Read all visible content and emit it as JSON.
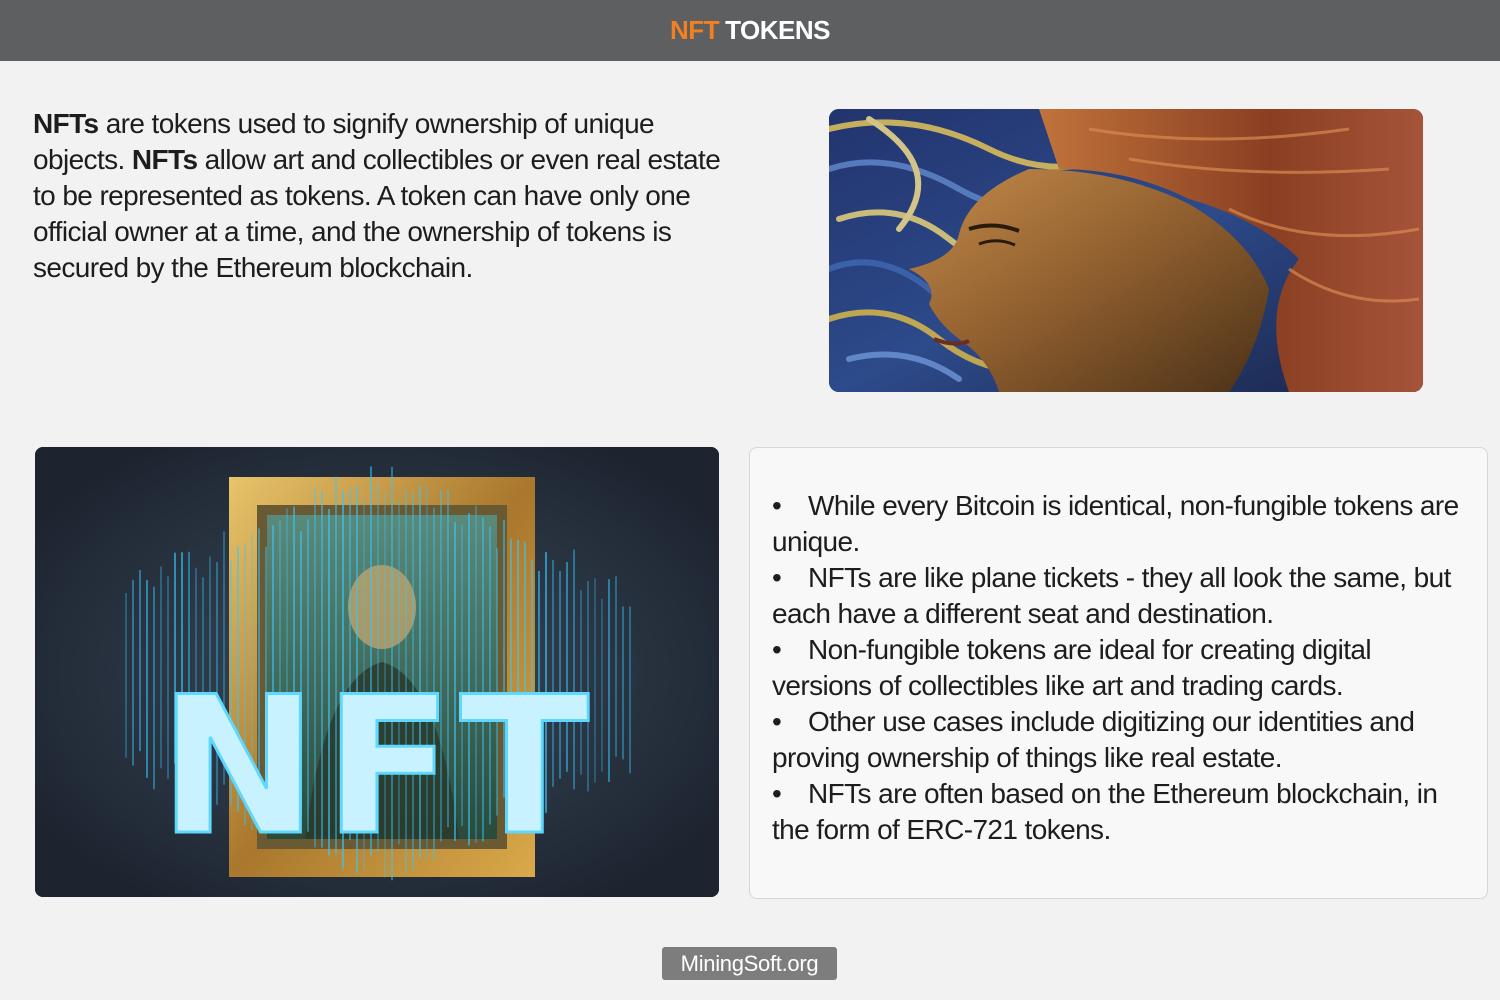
{
  "header": {
    "title_accent": "NFT",
    "title_rest": "TOKENS"
  },
  "intro": {
    "p1_bold": "NFTs",
    "p1_text": " are tokens used to signify ownership of unique objects. ",
    "p2_bold": "NFTs",
    "p2_text": " allow art and collectibles or even real estate to be represented as tokens. A token can have only one official owner at a time, and the ownership of tokens is secured by the Ethereum blockchain."
  },
  "images": {
    "portrait": {
      "icon": "painted-portrait-image"
    },
    "nft": {
      "icon": "mona-lisa-nft-image",
      "overlay_text": "NFT"
    }
  },
  "bullets": {
    "bullet_char": "•",
    "items": [
      "While every Bitcoin is identical, non-fungible tokens are unique.",
      "NFTs are like plane tickets - they all look the same, but each have a different seat and destination.",
      "Non-fungible tokens are ideal for creating digital versions of collectibles like art and trading cards.",
      "Other use cases include digitizing our identities and proving ownership of things like real estate.",
      "NFTs are often based on the Ethereum blockchain, in the form of ERC-721 tokens."
    ]
  },
  "footer": {
    "label": "MiningSoft.org"
  },
  "colors": {
    "accent": "#f47f20",
    "header_bg": "#5e5f61",
    "page_bg": "#f2f2f2",
    "footer_bg": "#7d7d7d"
  }
}
